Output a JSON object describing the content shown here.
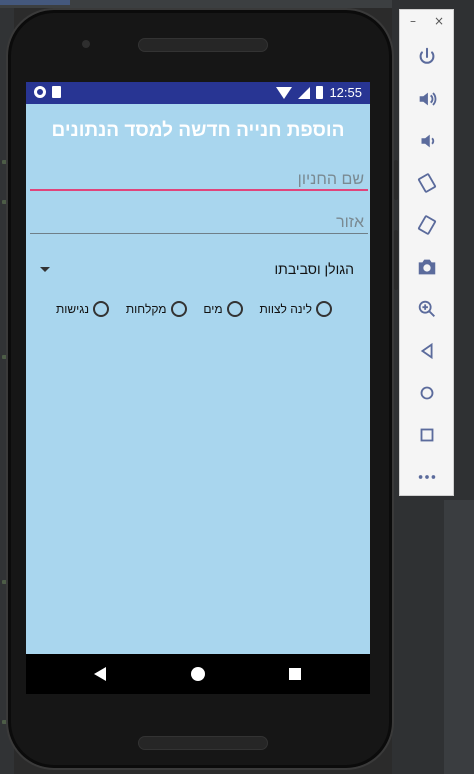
{
  "app": {
    "title": "הוספת חנייה חדשה למסד הנתונים",
    "fields": {
      "name_placeholder": "שם החניון",
      "area_placeholder": "אזור"
    },
    "spinner": {
      "selected": "הגולן וסביבתו"
    },
    "radios": [
      {
        "label": "לינה לצוות",
        "checked": false
      },
      {
        "label": "מים",
        "checked": false
      },
      {
        "label": "מקלחות",
        "checked": false
      },
      {
        "label": "נגישות",
        "checked": false
      }
    ]
  },
  "statusbar": {
    "time": "12:55",
    "color": "#283593"
  },
  "emulator_panel": {
    "minimize_label": "–",
    "close_label": "×",
    "buttons": [
      "power-icon",
      "volume-up-icon",
      "volume-down-icon",
      "rotate-left-icon",
      "rotate-right-icon",
      "camera-icon",
      "zoom-icon",
      "back-icon",
      "home-icon",
      "overview-icon",
      "more-icon"
    ]
  },
  "colors": {
    "screen_bg": "#a9d6ee",
    "accent_underline": "#e0457b"
  }
}
